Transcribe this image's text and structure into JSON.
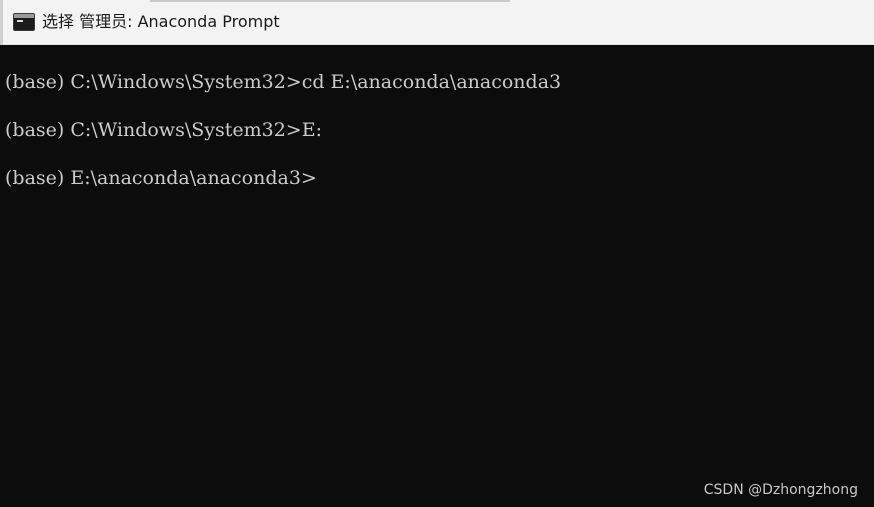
{
  "window": {
    "title": "选择 管理员: Anaconda Prompt",
    "icon": "terminal-icon"
  },
  "console": {
    "lines": [
      "(base) C:\\Windows\\System32>cd E:\\anaconda\\anaconda3",
      "(base) C:\\Windows\\System32>E:",
      "(base) E:\\anaconda\\anaconda3>"
    ]
  },
  "watermark": "CSDN @Dzhongzhong",
  "colors": {
    "titlebar_bg": "#f3f3f3",
    "console_bg": "#0c0c0c",
    "console_text": "#cccccc"
  }
}
